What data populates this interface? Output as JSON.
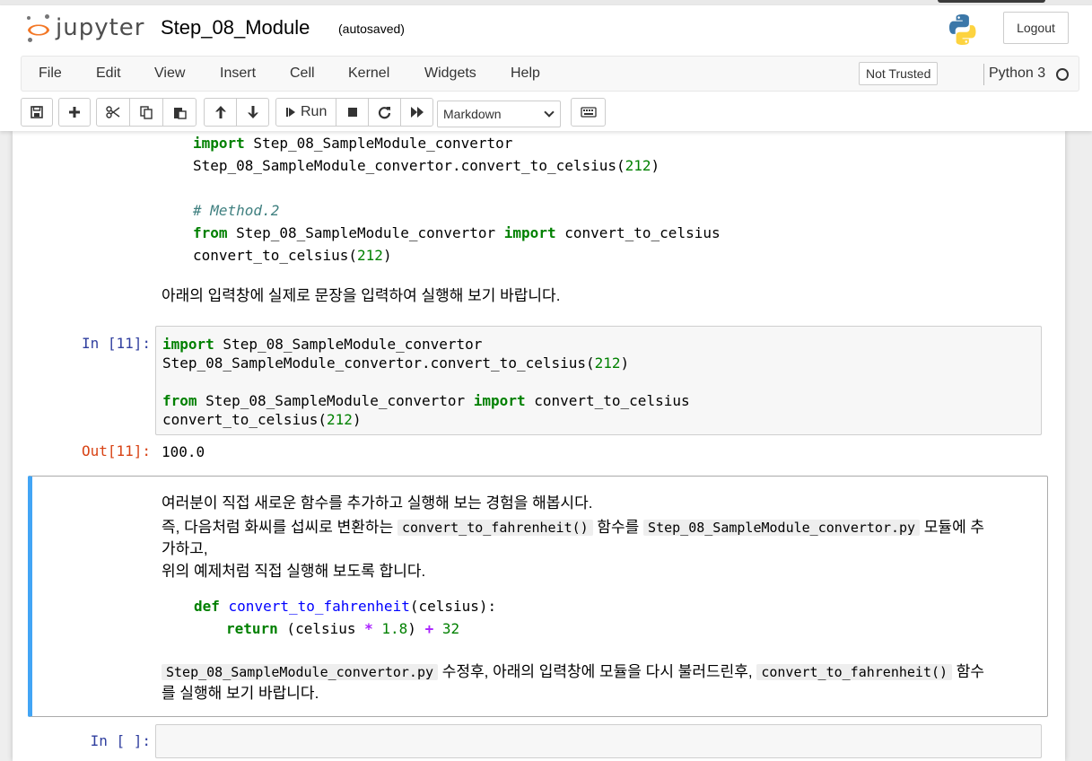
{
  "header": {
    "logo_text": "jupyter",
    "notebook_title": "Step_08_Module",
    "autosave_status": "(autosaved)",
    "logout_label": "Logout"
  },
  "menu": {
    "items": [
      "File",
      "Edit",
      "View",
      "Insert",
      "Cell",
      "Kernel",
      "Widgets",
      "Help"
    ],
    "trust_status": "Not Trusted",
    "kernel_name": "Python 3"
  },
  "toolbar": {
    "run_label": "Run",
    "cell_type": "Markdown"
  },
  "cells": {
    "md_top": {
      "code_lines": {
        "l1_kw": "import",
        "l1_rest": " Step_08_SampleModule_convertor",
        "l2_a": "Step_08_SampleModule_convertor.convert_to_celsius(",
        "l2_num": "212",
        "l2_b": ")",
        "l3_comment": "# Method.2",
        "l4_kw1": "from",
        "l4_mid": " Step_08_SampleModule_convertor ",
        "l4_kw2": "import",
        "l4_rest": " convert_to_celsius",
        "l5_a": "convert_to_celsius(",
        "l5_num": "212",
        "l5_b": ")"
      },
      "text": "아래의 입력창에 실제로 문장을 입력하여 실행해 보기 바랍니다."
    },
    "code_11": {
      "prompt": "In [11]:",
      "l1_kw": "import",
      "l1_rest": " Step_08_SampleModule_convertor",
      "l2_a": "Step_08_SampleModule_convertor.convert_to_celsius(",
      "l2_num": "212",
      "l2_b": ")",
      "l4_kw1": "from",
      "l4_mid": " Step_08_SampleModule_convertor ",
      "l4_kw2": "import",
      "l4_rest": " convert_to_celsius",
      "l5_a": "convert_to_celsius(",
      "l5_num": "212",
      "l5_b": ")",
      "out_prompt": "Out[11]:",
      "output": "100.0"
    },
    "md_selected": {
      "p1": "여러분이 직접 새로운 함수를 추가하고 실행해 보는 경험을 해봅시다.",
      "p2_a": "즉, 다음처럼 화씨를 섭씨로 변환하는 ",
      "p2_code1": "convert_to_fahrenheit()",
      "p2_b": " 함수를 ",
      "p2_code2": "Step_08_SampleModule_convertor.py",
      "p2_c": " 모듈에 추",
      "p2_d": "가하고,",
      "p3": "위의 예제처럼 직접 실행해 보도록 합니다.",
      "c1_kw": "def",
      "c1_fn": " convert_to_fahrenheit",
      "c1_rest": "(celsius):",
      "c2_kw": "return",
      "c2_a": " (celsius ",
      "c2_op1": "*",
      "c2_num1": " 1.8",
      "c2_b": ") ",
      "c2_op2": "+",
      "c2_num2": " 32",
      "p4_code1": "Step_08_SampleModule_convertor.py",
      "p4_a": " 수정후, 아래의 입력창에 모듈을 다시 불러드린후, ",
      "p4_code2": "convert_to_fahrenheit()",
      "p4_b": " 함수",
      "p5": "를 실행해 보기 바랍니다."
    },
    "code_empty": {
      "prompt": "In [ ]:"
    }
  },
  "colors": {
    "accent_selected": "#42A5F5",
    "jupyter_orange": "#F37726",
    "keyword_green": "#008000",
    "in_prompt": "#303F9F",
    "out_prompt": "#D84315"
  }
}
